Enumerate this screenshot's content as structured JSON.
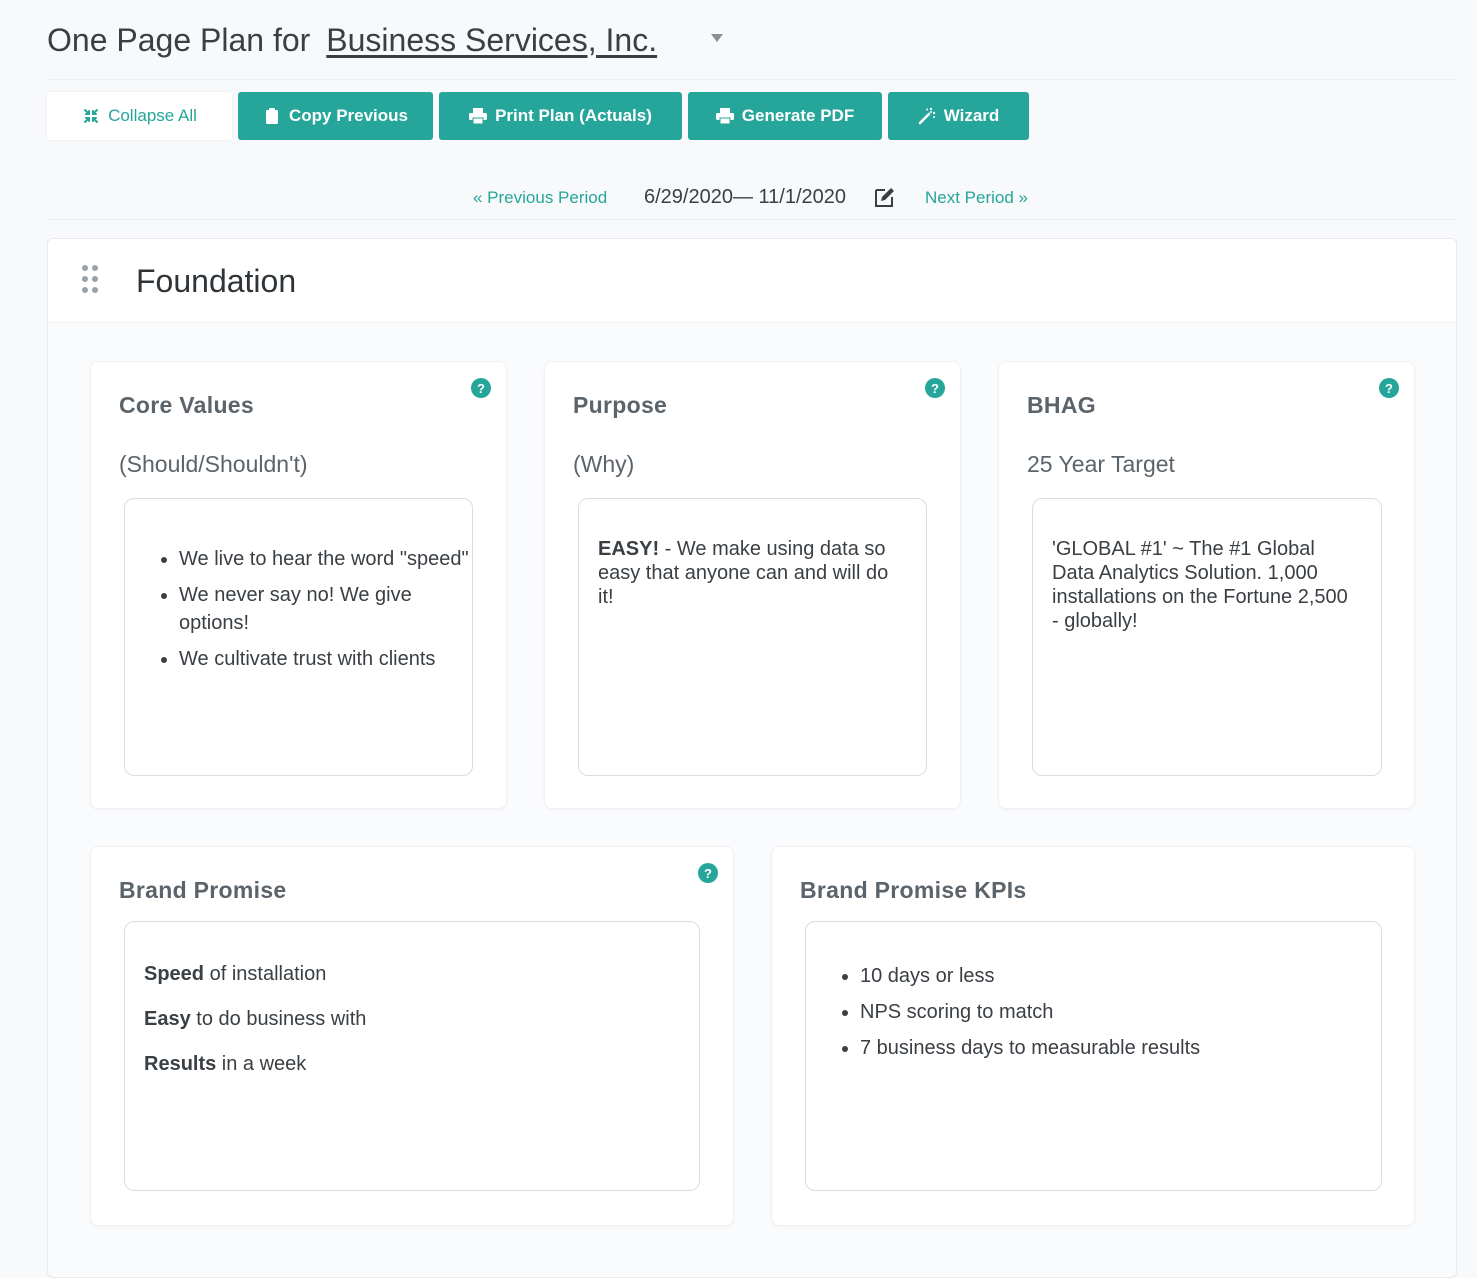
{
  "header": {
    "title_prefix": "One Page Plan for",
    "company": "Business Services, Inc."
  },
  "toolbar": {
    "collapse_label": "Collapse All",
    "copy_label": "Copy Previous",
    "print_label": "Print Plan (Actuals)",
    "pdf_label": "Generate PDF",
    "wizard_label": "Wizard"
  },
  "period": {
    "prev_label": "« Previous Period",
    "range": "6/29/2020— 11/1/2020",
    "next_label": "Next Period »"
  },
  "section": {
    "title": "Foundation"
  },
  "cards": {
    "core_values": {
      "title": "Core Values",
      "subtitle": "(Should/Shouldn't)",
      "items": [
        "We live to hear the word \"speed\"",
        "We never say no! We give options!",
        "We cultivate trust with clients"
      ]
    },
    "purpose": {
      "title": "Purpose",
      "subtitle": "(Why)",
      "bold": "EASY!",
      "text": " - We make using data so easy that anyone can and will do it!"
    },
    "bhag": {
      "title": "BHAG",
      "subtitle": "25 Year Target",
      "text": "'GLOBAL #1' ~ The #1 Global Data Analytics Solution. 1,000 installations on the Fortune 2,500 - globally!"
    },
    "brand_promise": {
      "title": "Brand Promise",
      "lines": [
        {
          "bold": "Speed",
          "text": " of installation"
        },
        {
          "bold": "Easy",
          "text": " to do business with"
        },
        {
          "bold": "Results",
          "text": " in a week"
        }
      ]
    },
    "brand_kpis": {
      "title": "Brand Promise KPIs",
      "items": [
        "10 days or less",
        "NPS scoring to match",
        "7 business days to measurable results"
      ]
    }
  },
  "help_icon": "?",
  "colors": {
    "accent": "#26a69a",
    "text": "#3a3f44",
    "muted": "#5b636b"
  },
  "icons": [
    "collapse-icon",
    "clipboard-icon",
    "printer-icon",
    "magic-wand-icon",
    "edit-icon",
    "drag-handle-icon",
    "help-icon",
    "caret-down-icon"
  ]
}
